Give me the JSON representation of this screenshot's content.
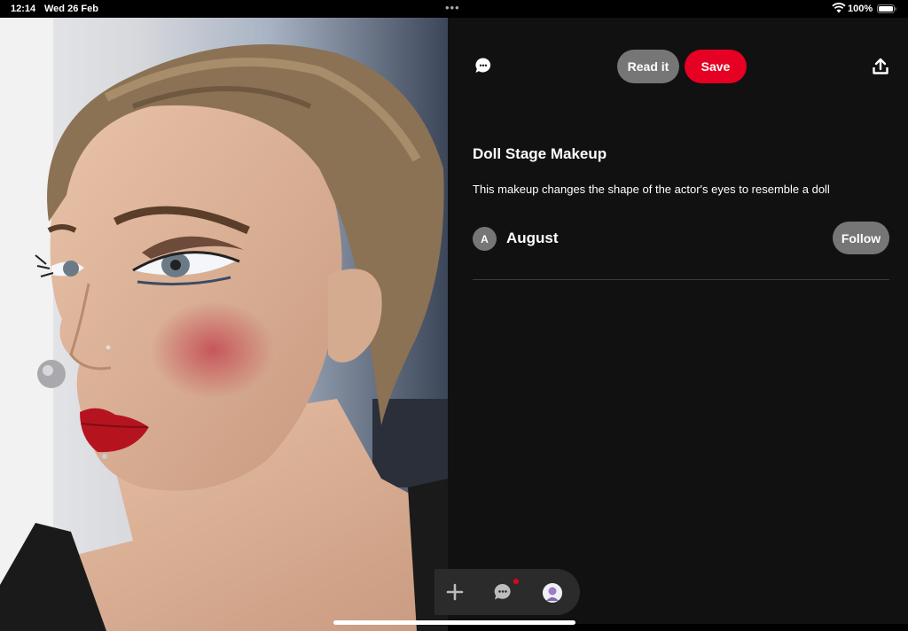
{
  "status_bar": {
    "time": "12:14",
    "date": "Wed 26 Feb",
    "battery": "100%",
    "multitask_dots": "•••"
  },
  "pin": {
    "image_icon": "photo-of-woman-in-stage-makeup",
    "title": "Doll Stage Makeup",
    "description": "This makeup changes the shape of the actor's eyes to resemble a doll"
  },
  "toolbar": {
    "comment_icon": "speech-bubble-icon",
    "read_label": "Read it",
    "save_label": "Save",
    "share_icon": "upload-share-icon"
  },
  "author": {
    "initial": "A",
    "name": "August",
    "follow_label": "Follow"
  },
  "bottom_nav": {
    "create_icon": "plus-icon",
    "messages_icon": "chat-icon",
    "profile_icon": "avatar-icon"
  },
  "colors": {
    "accent": "#e60023",
    "button_grey": "#767676",
    "background": "#111111"
  }
}
